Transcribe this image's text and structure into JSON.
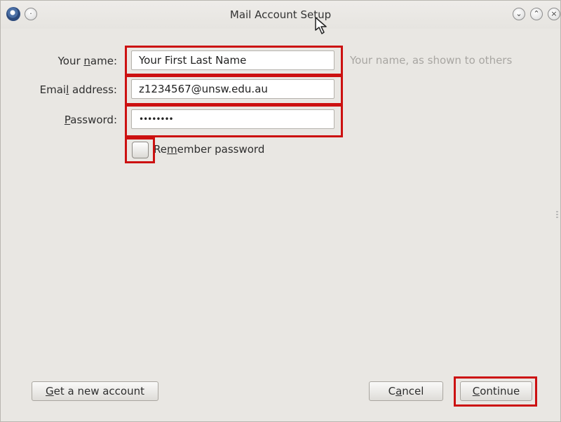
{
  "window": {
    "title": "Mail Account Setup",
    "controls": [
      "minimize",
      "maximize",
      "close"
    ]
  },
  "form": {
    "name": {
      "label_prefix": "Your ",
      "label_accel": "n",
      "label_suffix": "ame:",
      "value": "Your First Last Name",
      "hint": "Your name, as shown to others"
    },
    "email": {
      "label_prefix": "Emai",
      "label_accel": "l",
      "label_suffix": " address:",
      "value": "z1234567@unsw.edu.au"
    },
    "password": {
      "label_prefix": "",
      "label_accel": "P",
      "label_suffix": "assword:",
      "value": "••••••••"
    },
    "remember": {
      "label_prefix": "Re",
      "label_accel": "m",
      "label_suffix": "ember password",
      "checked": false
    }
  },
  "buttons": {
    "get_account": {
      "accel": "G",
      "rest": "et a new account"
    },
    "cancel": {
      "prefix": "C",
      "accel": "a",
      "rest": "ncel"
    },
    "continue": {
      "accel": "C",
      "rest": "ontinue"
    }
  },
  "highlight_color": "#cc1111"
}
